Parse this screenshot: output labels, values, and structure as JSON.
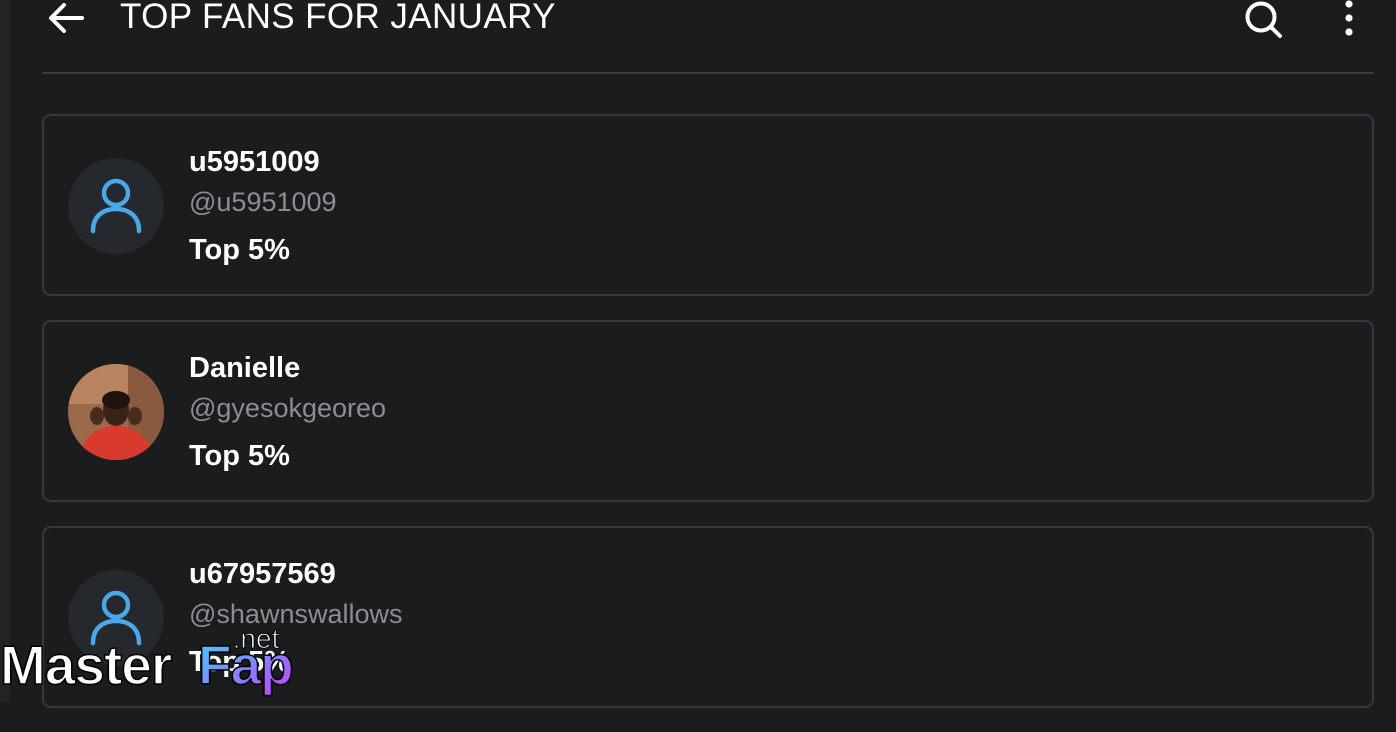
{
  "header": {
    "title": "TOP FANS FOR JANUARY",
    "back_icon": "arrow-left-icon",
    "search_icon": "search-icon",
    "more_icon": "more-vertical-icon"
  },
  "fans": [
    {
      "name": "u5951009",
      "handle": "@u5951009",
      "rank": "Top 5%",
      "avatar": "default-user-icon"
    },
    {
      "name": "Danielle",
      "handle": "@gyesokgeoreo",
      "rank": "Top 5%",
      "avatar": "profile-photo"
    },
    {
      "name": "u67957569",
      "handle": "@shawnswallows",
      "rank": "Top 5%",
      "avatar": "default-user-icon"
    }
  ],
  "watermark": {
    "text": "MasterFap",
    "suffix": ".net"
  },
  "colors": {
    "background": "#1b1c1e",
    "card_border": "#36373a",
    "accent_icon": "#4aa8e8",
    "handle_text": "#8a8d92"
  }
}
